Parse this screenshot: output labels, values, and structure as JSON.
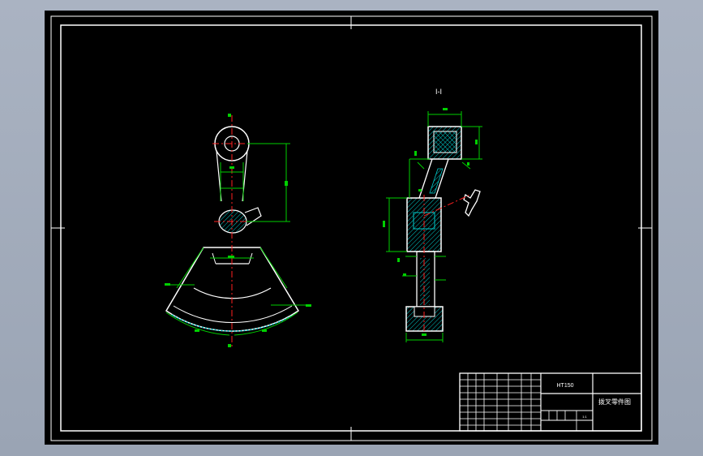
{
  "drawing": {
    "section_label": "I-I",
    "material": "HT150",
    "title": "拨叉零件图",
    "scale": "1:1",
    "background_color": "#000000",
    "line_color": "#ffffff",
    "dimension_color": "#00d000",
    "centerline_color": "#ff2020",
    "hatch_color": "#00c8c8"
  }
}
